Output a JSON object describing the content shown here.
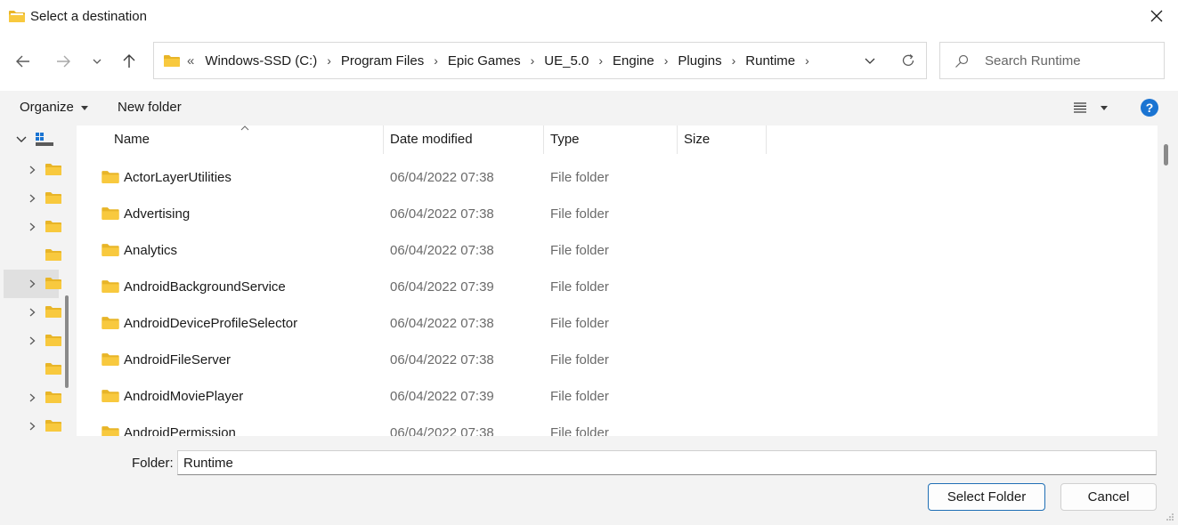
{
  "window": {
    "title": "Select a destination"
  },
  "address": {
    "overflow": "«",
    "crumbs": [
      "Windows-SSD (C:)",
      "Program Files",
      "Epic Games",
      "UE_5.0",
      "Engine",
      "Plugins",
      "Runtime"
    ]
  },
  "search": {
    "placeholder": "Search Runtime"
  },
  "toolbar": {
    "organize": "Organize",
    "new_folder": "New folder"
  },
  "columns": {
    "name": "Name",
    "date": "Date modified",
    "type": "Type",
    "size": "Size"
  },
  "files": [
    {
      "name": "ActorLayerUtilities",
      "date": "06/04/2022 07:38",
      "type": "File folder"
    },
    {
      "name": "Advertising",
      "date": "06/04/2022 07:38",
      "type": "File folder"
    },
    {
      "name": "Analytics",
      "date": "06/04/2022 07:38",
      "type": "File folder"
    },
    {
      "name": "AndroidBackgroundService",
      "date": "06/04/2022 07:39",
      "type": "File folder"
    },
    {
      "name": "AndroidDeviceProfileSelector",
      "date": "06/04/2022 07:38",
      "type": "File folder"
    },
    {
      "name": "AndroidFileServer",
      "date": "06/04/2022 07:38",
      "type": "File folder"
    },
    {
      "name": "AndroidMoviePlayer",
      "date": "06/04/2022 07:39",
      "type": "File folder"
    },
    {
      "name": "AndroidPermission",
      "date": "06/04/2022 07:38",
      "type": "File folder"
    }
  ],
  "folder_field": {
    "label": "Folder:",
    "value": "Runtime"
  },
  "buttons": {
    "select": "Select Folder",
    "cancel": "Cancel"
  },
  "colors": {
    "folder": "#f8c93e",
    "folder_dark": "#e8b528",
    "accent": "#1f6fb5",
    "help": "#1a74d2"
  }
}
